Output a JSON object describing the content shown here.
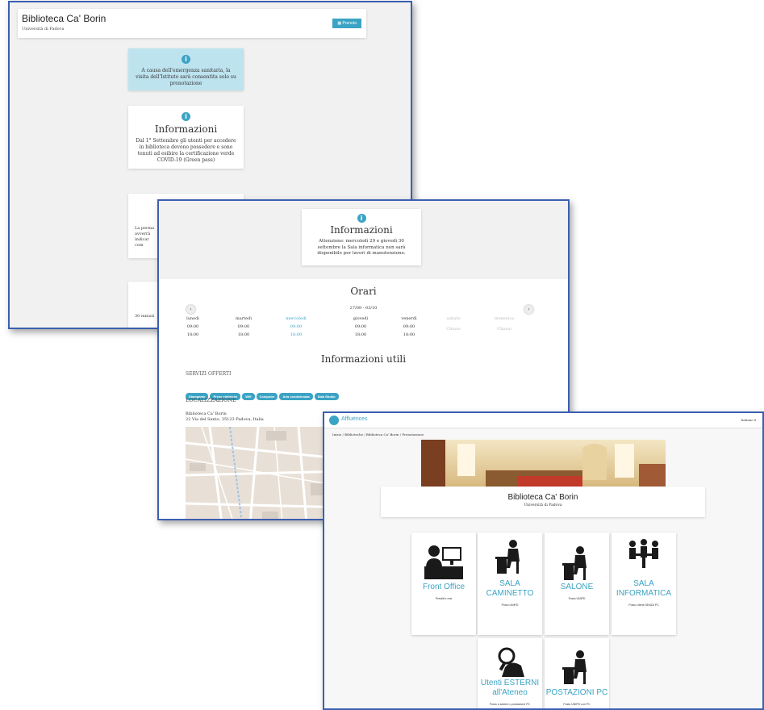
{
  "shot1": {
    "title": "Biblioteca Ca' Borin",
    "subtitle": "Università di Padova",
    "book_button": "Prenota",
    "alert_text": "A causa dell'emergenza sanitaria, la visita dell'Istituto sarà consentita solo su prenotazione",
    "info_title": "Informazioni",
    "info_text": "Dal 1° Settembre gli utenti per accedere in biblioteca devono possedere e sono tenuti ad esibire la certificazione verde COVID-19 (Green pass)",
    "partial_text_1": "La perma",
    "partial_text_2": "avverrà",
    "partial_text_3": "indicat",
    "partial_text_4": "com",
    "partial_text_5": "30 minuti"
  },
  "shot2": {
    "info_title": "Informazioni",
    "info_text": "Attenzione: mercoledì 29 e giovedì 30 settembre la Sala informatica non sarà disponibile per lavori di manutenzione.",
    "hours_title": "Orari",
    "date_range": "27/09 - 03/10",
    "days": [
      {
        "name": "lunedì",
        "open": "09:00",
        "close": "18:00"
      },
      {
        "name": "martedì",
        "open": "09:00",
        "close": "18:00"
      },
      {
        "name": "mercoledì",
        "open": "09:00",
        "close": "18:00"
      },
      {
        "name": "giovedì",
        "open": "09:00",
        "close": "18:00"
      },
      {
        "name": "venerdì",
        "open": "09:00",
        "close": "18:00"
      },
      {
        "name": "sabato",
        "open": "Chiuso",
        "close": ""
      },
      {
        "name": "domenica",
        "open": "Chiuso",
        "close": ""
      }
    ],
    "useful_title": "Informazioni utili",
    "services_label": "SERVIZI OFFERTI",
    "services": [
      "Stampante",
      "Prese elettriche",
      "Wifi",
      "Computer",
      "Aria condizionata",
      "Sala Studio"
    ],
    "location_label": "LOCALIZZAZIONE",
    "address_line1": "Biblioteca Ca' Borin",
    "address_line2": "22 Via del Santo, 35123 Padova, Italia"
  },
  "shot3": {
    "brand": "Affluences",
    "language": "Italiano ▾",
    "breadcrumb": [
      "Inizio",
      "Biblioteche",
      "Biblioteca Ca' Borin",
      "Prenotazione"
    ],
    "title": "Biblioteca Ca' Borin",
    "subtitle": "Università di Padova",
    "tiles": [
      {
        "name": "Front Office",
        "sub": "Prestiti e resi"
      },
      {
        "name": "SALA CAMINETTO",
        "sub": "Posto UNIPD"
      },
      {
        "name": "SALONE",
        "sub": "Posto UNIPD"
      },
      {
        "name": "SALA INFORMATICA",
        "sub": "Posto Utenti SENZA PC"
      },
      {
        "name": "Utenti ESTERNI all'Ateneo",
        "sub": "Posto a sedere o postazione PC"
      },
      {
        "name": "POSTAZIONI PC",
        "sub": "Posto UNIPD con PC"
      }
    ]
  },
  "colors": {
    "accent": "#3ba3c4",
    "frame": "#3b5fb0",
    "alert_bg": "#bde3ef"
  }
}
